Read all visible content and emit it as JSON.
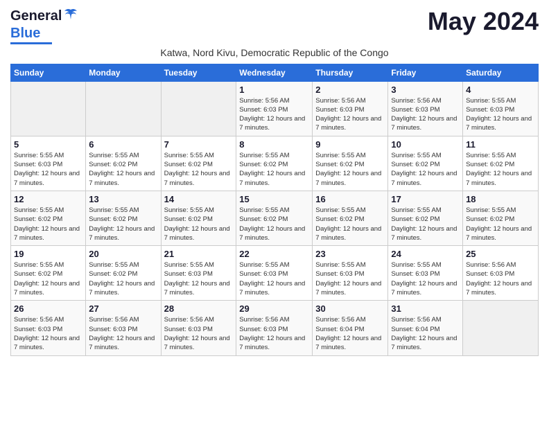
{
  "logo": {
    "general": "General",
    "blue": "Blue"
  },
  "title": "May 2024",
  "subtitle": "Katwa, Nord Kivu, Democratic Republic of the Congo",
  "days_of_week": [
    "Sunday",
    "Monday",
    "Tuesday",
    "Wednesday",
    "Thursday",
    "Friday",
    "Saturday"
  ],
  "weeks": [
    [
      {
        "day": "",
        "info": ""
      },
      {
        "day": "",
        "info": ""
      },
      {
        "day": "",
        "info": ""
      },
      {
        "day": "1",
        "info": "Sunrise: 5:56 AM\nSunset: 6:03 PM\nDaylight: 12 hours and 7 minutes."
      },
      {
        "day": "2",
        "info": "Sunrise: 5:56 AM\nSunset: 6:03 PM\nDaylight: 12 hours and 7 minutes."
      },
      {
        "day": "3",
        "info": "Sunrise: 5:56 AM\nSunset: 6:03 PM\nDaylight: 12 hours and 7 minutes."
      },
      {
        "day": "4",
        "info": "Sunrise: 5:55 AM\nSunset: 6:03 PM\nDaylight: 12 hours and 7 minutes."
      }
    ],
    [
      {
        "day": "5",
        "info": "Sunrise: 5:55 AM\nSunset: 6:03 PM\nDaylight: 12 hours and 7 minutes."
      },
      {
        "day": "6",
        "info": "Sunrise: 5:55 AM\nSunset: 6:02 PM\nDaylight: 12 hours and 7 minutes."
      },
      {
        "day": "7",
        "info": "Sunrise: 5:55 AM\nSunset: 6:02 PM\nDaylight: 12 hours and 7 minutes."
      },
      {
        "day": "8",
        "info": "Sunrise: 5:55 AM\nSunset: 6:02 PM\nDaylight: 12 hours and 7 minutes."
      },
      {
        "day": "9",
        "info": "Sunrise: 5:55 AM\nSunset: 6:02 PM\nDaylight: 12 hours and 7 minutes."
      },
      {
        "day": "10",
        "info": "Sunrise: 5:55 AM\nSunset: 6:02 PM\nDaylight: 12 hours and 7 minutes."
      },
      {
        "day": "11",
        "info": "Sunrise: 5:55 AM\nSunset: 6:02 PM\nDaylight: 12 hours and 7 minutes."
      }
    ],
    [
      {
        "day": "12",
        "info": "Sunrise: 5:55 AM\nSunset: 6:02 PM\nDaylight: 12 hours and 7 minutes."
      },
      {
        "day": "13",
        "info": "Sunrise: 5:55 AM\nSunset: 6:02 PM\nDaylight: 12 hours and 7 minutes."
      },
      {
        "day": "14",
        "info": "Sunrise: 5:55 AM\nSunset: 6:02 PM\nDaylight: 12 hours and 7 minutes."
      },
      {
        "day": "15",
        "info": "Sunrise: 5:55 AM\nSunset: 6:02 PM\nDaylight: 12 hours and 7 minutes."
      },
      {
        "day": "16",
        "info": "Sunrise: 5:55 AM\nSunset: 6:02 PM\nDaylight: 12 hours and 7 minutes."
      },
      {
        "day": "17",
        "info": "Sunrise: 5:55 AM\nSunset: 6:02 PM\nDaylight: 12 hours and 7 minutes."
      },
      {
        "day": "18",
        "info": "Sunrise: 5:55 AM\nSunset: 6:02 PM\nDaylight: 12 hours and 7 minutes."
      }
    ],
    [
      {
        "day": "19",
        "info": "Sunrise: 5:55 AM\nSunset: 6:02 PM\nDaylight: 12 hours and 7 minutes."
      },
      {
        "day": "20",
        "info": "Sunrise: 5:55 AM\nSunset: 6:02 PM\nDaylight: 12 hours and 7 minutes."
      },
      {
        "day": "21",
        "info": "Sunrise: 5:55 AM\nSunset: 6:03 PM\nDaylight: 12 hours and 7 minutes."
      },
      {
        "day": "22",
        "info": "Sunrise: 5:55 AM\nSunset: 6:03 PM\nDaylight: 12 hours and 7 minutes."
      },
      {
        "day": "23",
        "info": "Sunrise: 5:55 AM\nSunset: 6:03 PM\nDaylight: 12 hours and 7 minutes."
      },
      {
        "day": "24",
        "info": "Sunrise: 5:55 AM\nSunset: 6:03 PM\nDaylight: 12 hours and 7 minutes."
      },
      {
        "day": "25",
        "info": "Sunrise: 5:56 AM\nSunset: 6:03 PM\nDaylight: 12 hours and 7 minutes."
      }
    ],
    [
      {
        "day": "26",
        "info": "Sunrise: 5:56 AM\nSunset: 6:03 PM\nDaylight: 12 hours and 7 minutes."
      },
      {
        "day": "27",
        "info": "Sunrise: 5:56 AM\nSunset: 6:03 PM\nDaylight: 12 hours and 7 minutes."
      },
      {
        "day": "28",
        "info": "Sunrise: 5:56 AM\nSunset: 6:03 PM\nDaylight: 12 hours and 7 minutes."
      },
      {
        "day": "29",
        "info": "Sunrise: 5:56 AM\nSunset: 6:03 PM\nDaylight: 12 hours and 7 minutes."
      },
      {
        "day": "30",
        "info": "Sunrise: 5:56 AM\nSunset: 6:04 PM\nDaylight: 12 hours and 7 minutes."
      },
      {
        "day": "31",
        "info": "Sunrise: 5:56 AM\nSunset: 6:04 PM\nDaylight: 12 hours and 7 minutes."
      },
      {
        "day": "",
        "info": ""
      }
    ]
  ]
}
